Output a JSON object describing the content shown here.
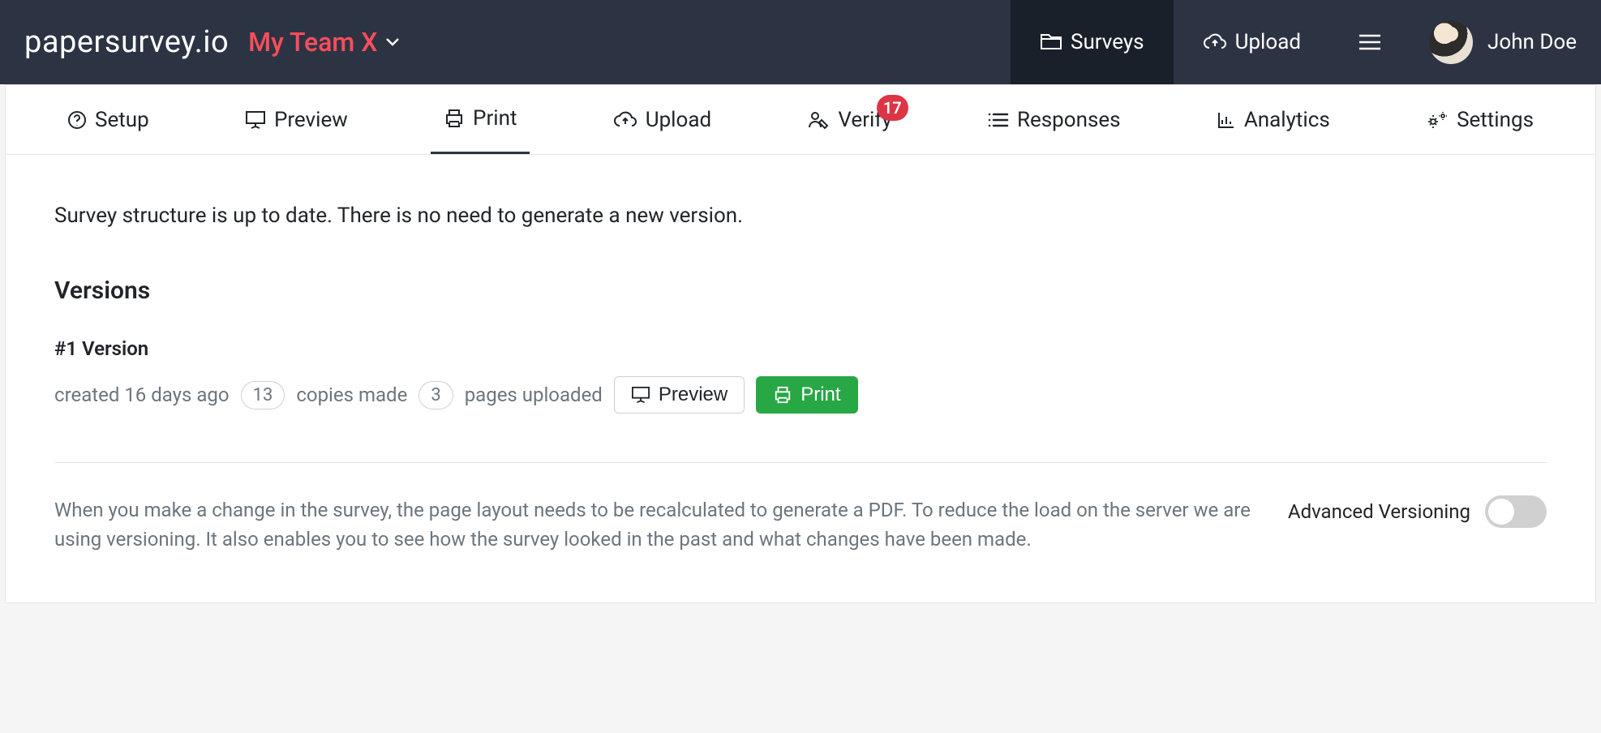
{
  "header": {
    "brand": "papersurvey.io",
    "team": "My Team X",
    "nav": {
      "surveys": "Surveys",
      "upload": "Upload"
    },
    "user_name": "John Doe"
  },
  "tabs": {
    "setup": "Setup",
    "preview": "Preview",
    "print": "Print",
    "upload": "Upload",
    "verify": "Verify",
    "verify_badge": "17",
    "responses": "Responses",
    "analytics": "Analytics",
    "settings": "Settings"
  },
  "main": {
    "status": "Survey structure is up to date. There is no need to generate a new version.",
    "versions_heading": "Versions",
    "version": {
      "title": "#1 Version",
      "created": "created 16 days ago",
      "copies_count": "13",
      "copies_label": "copies made",
      "pages_count": "3",
      "pages_label": "pages uploaded",
      "preview_btn": "Preview",
      "print_btn": "Print"
    },
    "footer": {
      "description": "When you make a change in the survey, the page layout needs to be recalculated to generate a PDF. To reduce the load on the server we are using versioning. It also enables you to see how the survey looked in the past and what changes have been made.",
      "advanced_label": "Advanced Versioning"
    }
  }
}
